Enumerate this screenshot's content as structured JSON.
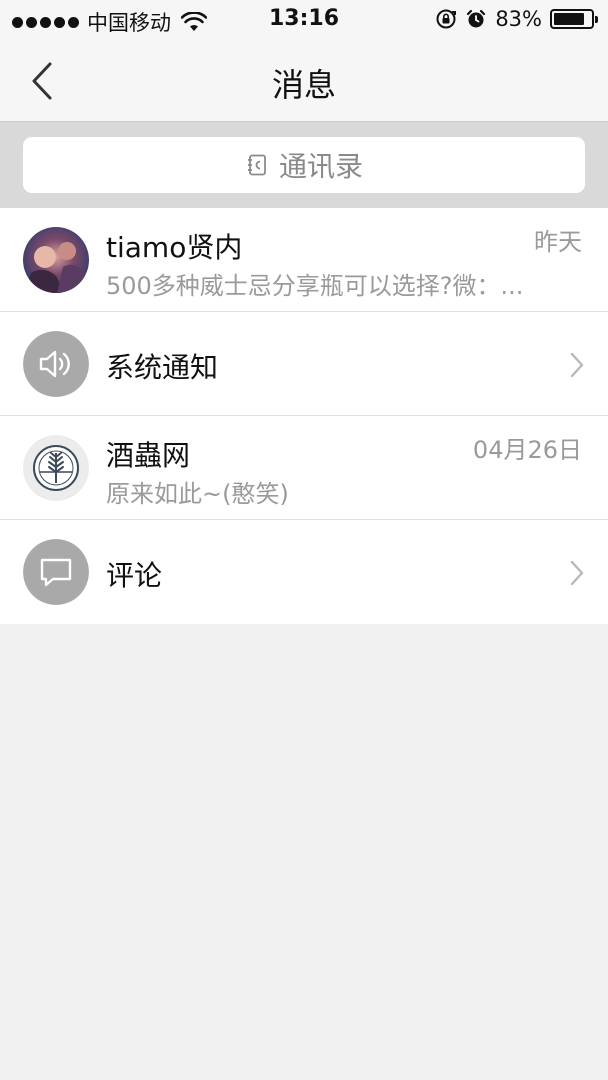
{
  "status_bar": {
    "carrier": "中国移动",
    "time": "13:16",
    "battery_percent": "83%",
    "battery_level": 0.83
  },
  "nav": {
    "title": "消息"
  },
  "search": {
    "label": "通讯录"
  },
  "messages": [
    {
      "title": "tiamo贤内",
      "subtitle": "500多种威士忌分享瓶可以选择?微：...",
      "time": "昨天"
    },
    {
      "title": "系统通知"
    },
    {
      "title": "酒蟲网",
      "subtitle": "原来如此~(憨笑)",
      "time": "04月26日"
    },
    {
      "title": "评论"
    }
  ],
  "colors": {
    "icon_gray": "#a9a9a9",
    "background": "#f1f1f1",
    "search_area": "#d9d9d9"
  }
}
